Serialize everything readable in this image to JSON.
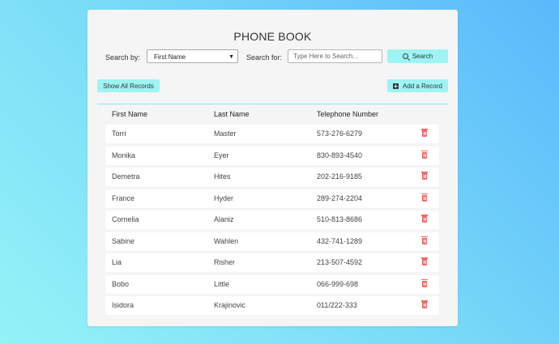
{
  "title": "PHONE BOOK",
  "search": {
    "search_by_label": "Search by:",
    "search_by_value": "First Name",
    "search_for_label": "Search for:",
    "placeholder": "Type Here to Search...",
    "search_button": "Search"
  },
  "actions": {
    "show_all": "Show All Records",
    "add_record": "Add a Record"
  },
  "table": {
    "columns": [
      "First Name",
      "Last Name",
      "Telephone Number"
    ],
    "rows": [
      {
        "first": "Torri",
        "last": "Master",
        "phone": "573-276-6279"
      },
      {
        "first": "Monika",
        "last": "Eyer",
        "phone": "830-893-4540"
      },
      {
        "first": "Demetra",
        "last": "Hites",
        "phone": "202-216-9185"
      },
      {
        "first": "France",
        "last": "Hyder",
        "phone": "289-274-2204"
      },
      {
        "first": "Cornelia",
        "last": "Alaniz",
        "phone": "510-813-8686"
      },
      {
        "first": "Sabine",
        "last": "Wahlen",
        "phone": "432-741-1289"
      },
      {
        "first": "Lia",
        "last": "Risher",
        "phone": "213-507-4592"
      },
      {
        "first": "Bobo",
        "last": "Little",
        "phone": "066-999-698"
      },
      {
        "first": "Isidora",
        "last": "Krajinovic",
        "phone": "011/222-333"
      }
    ]
  },
  "colors": {
    "accent": "#9ef4f4",
    "delete": "#ee6b6b",
    "divider": "#7fe7ef"
  },
  "icons": {
    "search": "search-icon",
    "add": "plus-square-icon",
    "delete": "trash-icon"
  }
}
